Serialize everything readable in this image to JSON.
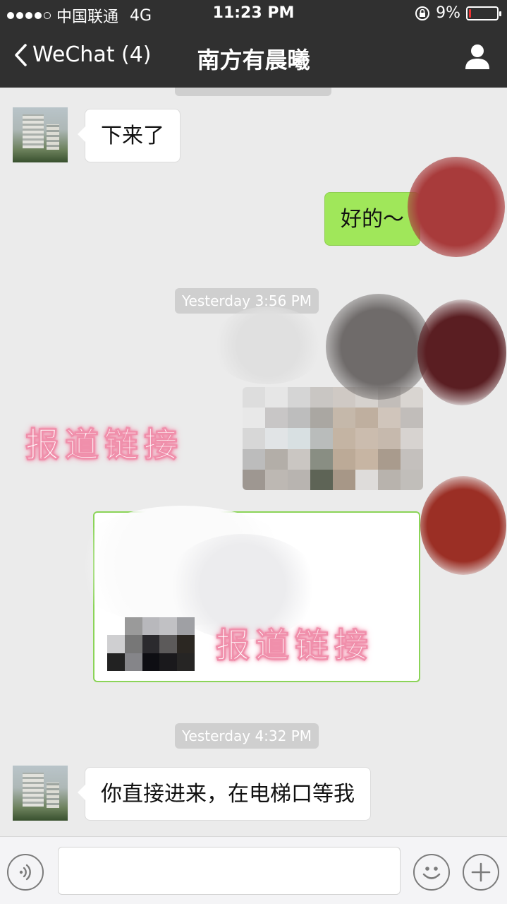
{
  "status_bar": {
    "carrier": "中国联通",
    "network": "4G",
    "time": "11:23 PM",
    "battery_percent": "9%",
    "battery_level": 0.09
  },
  "nav": {
    "back_label": "WeChat (4)",
    "title": "南方有晨曦"
  },
  "messages": [
    {
      "side": "in",
      "text": "下来了"
    },
    {
      "side": "out",
      "text": "好的～"
    }
  ],
  "timestamps": [
    "Yesterday 3:56 PM",
    "Yesterday 4:32 PM"
  ],
  "watermark": "报道链接",
  "last_message": {
    "side": "in",
    "text": "你直接进来，在电梯口等我"
  },
  "colors": {
    "header": "#303030",
    "chat_bg": "#ebebeb",
    "bubble_out": "#a0e75a",
    "bubble_in": "#ffffff",
    "watermark": "#f089a6"
  },
  "icons": {
    "back": "chevron-left-icon",
    "profile": "person-icon",
    "voice": "voice-icon",
    "emoji": "emoji-icon",
    "plus": "plus-icon"
  }
}
